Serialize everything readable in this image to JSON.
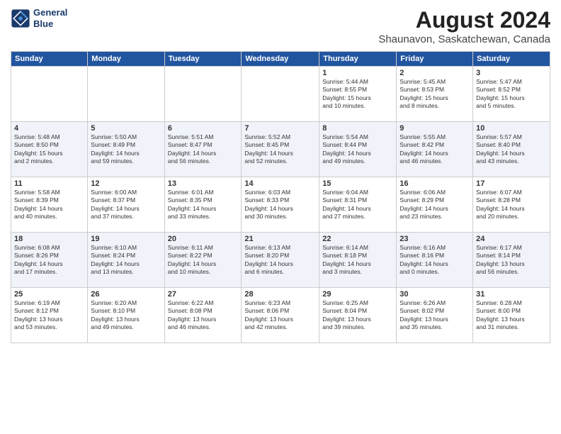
{
  "logo": {
    "line1": "General",
    "line2": "Blue"
  },
  "title": "August 2024",
  "location": "Shaunavon, Saskatchewan, Canada",
  "days_of_week": [
    "Sunday",
    "Monday",
    "Tuesday",
    "Wednesday",
    "Thursday",
    "Friday",
    "Saturday"
  ],
  "weeks": [
    [
      {
        "day": "",
        "info": ""
      },
      {
        "day": "",
        "info": ""
      },
      {
        "day": "",
        "info": ""
      },
      {
        "day": "",
        "info": ""
      },
      {
        "day": "1",
        "info": "Sunrise: 5:44 AM\nSunset: 8:55 PM\nDaylight: 15 hours\nand 10 minutes."
      },
      {
        "day": "2",
        "info": "Sunrise: 5:45 AM\nSunset: 8:53 PM\nDaylight: 15 hours\nand 8 minutes."
      },
      {
        "day": "3",
        "info": "Sunrise: 5:47 AM\nSunset: 8:52 PM\nDaylight: 15 hours\nand 5 minutes."
      }
    ],
    [
      {
        "day": "4",
        "info": "Sunrise: 5:48 AM\nSunset: 8:50 PM\nDaylight: 15 hours\nand 2 minutes."
      },
      {
        "day": "5",
        "info": "Sunrise: 5:50 AM\nSunset: 8:49 PM\nDaylight: 14 hours\nand 59 minutes."
      },
      {
        "day": "6",
        "info": "Sunrise: 5:51 AM\nSunset: 8:47 PM\nDaylight: 14 hours\nand 56 minutes."
      },
      {
        "day": "7",
        "info": "Sunrise: 5:52 AM\nSunset: 8:45 PM\nDaylight: 14 hours\nand 52 minutes."
      },
      {
        "day": "8",
        "info": "Sunrise: 5:54 AM\nSunset: 8:44 PM\nDaylight: 14 hours\nand 49 minutes."
      },
      {
        "day": "9",
        "info": "Sunrise: 5:55 AM\nSunset: 8:42 PM\nDaylight: 14 hours\nand 46 minutes."
      },
      {
        "day": "10",
        "info": "Sunrise: 5:57 AM\nSunset: 8:40 PM\nDaylight: 14 hours\nand 43 minutes."
      }
    ],
    [
      {
        "day": "11",
        "info": "Sunrise: 5:58 AM\nSunset: 8:39 PM\nDaylight: 14 hours\nand 40 minutes."
      },
      {
        "day": "12",
        "info": "Sunrise: 6:00 AM\nSunset: 8:37 PM\nDaylight: 14 hours\nand 37 minutes."
      },
      {
        "day": "13",
        "info": "Sunrise: 6:01 AM\nSunset: 8:35 PM\nDaylight: 14 hours\nand 33 minutes."
      },
      {
        "day": "14",
        "info": "Sunrise: 6:03 AM\nSunset: 8:33 PM\nDaylight: 14 hours\nand 30 minutes."
      },
      {
        "day": "15",
        "info": "Sunrise: 6:04 AM\nSunset: 8:31 PM\nDaylight: 14 hours\nand 27 minutes."
      },
      {
        "day": "16",
        "info": "Sunrise: 6:06 AM\nSunset: 8:29 PM\nDaylight: 14 hours\nand 23 minutes."
      },
      {
        "day": "17",
        "info": "Sunrise: 6:07 AM\nSunset: 8:28 PM\nDaylight: 14 hours\nand 20 minutes."
      }
    ],
    [
      {
        "day": "18",
        "info": "Sunrise: 6:08 AM\nSunset: 8:26 PM\nDaylight: 14 hours\nand 17 minutes."
      },
      {
        "day": "19",
        "info": "Sunrise: 6:10 AM\nSunset: 8:24 PM\nDaylight: 14 hours\nand 13 minutes."
      },
      {
        "day": "20",
        "info": "Sunrise: 6:11 AM\nSunset: 8:22 PM\nDaylight: 14 hours\nand 10 minutes."
      },
      {
        "day": "21",
        "info": "Sunrise: 6:13 AM\nSunset: 8:20 PM\nDaylight: 14 hours\nand 6 minutes."
      },
      {
        "day": "22",
        "info": "Sunrise: 6:14 AM\nSunset: 8:18 PM\nDaylight: 14 hours\nand 3 minutes."
      },
      {
        "day": "23",
        "info": "Sunrise: 6:16 AM\nSunset: 8:16 PM\nDaylight: 14 hours\nand 0 minutes."
      },
      {
        "day": "24",
        "info": "Sunrise: 6:17 AM\nSunset: 8:14 PM\nDaylight: 13 hours\nand 56 minutes."
      }
    ],
    [
      {
        "day": "25",
        "info": "Sunrise: 6:19 AM\nSunset: 8:12 PM\nDaylight: 13 hours\nand 53 minutes."
      },
      {
        "day": "26",
        "info": "Sunrise: 6:20 AM\nSunset: 8:10 PM\nDaylight: 13 hours\nand 49 minutes."
      },
      {
        "day": "27",
        "info": "Sunrise: 6:22 AM\nSunset: 8:08 PM\nDaylight: 13 hours\nand 46 minutes."
      },
      {
        "day": "28",
        "info": "Sunrise: 6:23 AM\nSunset: 8:06 PM\nDaylight: 13 hours\nand 42 minutes."
      },
      {
        "day": "29",
        "info": "Sunrise: 6:25 AM\nSunset: 8:04 PM\nDaylight: 13 hours\nand 39 minutes."
      },
      {
        "day": "30",
        "info": "Sunrise: 6:26 AM\nSunset: 8:02 PM\nDaylight: 13 hours\nand 35 minutes."
      },
      {
        "day": "31",
        "info": "Sunrise: 6:28 AM\nSunset: 8:00 PM\nDaylight: 13 hours\nand 31 minutes."
      }
    ]
  ]
}
